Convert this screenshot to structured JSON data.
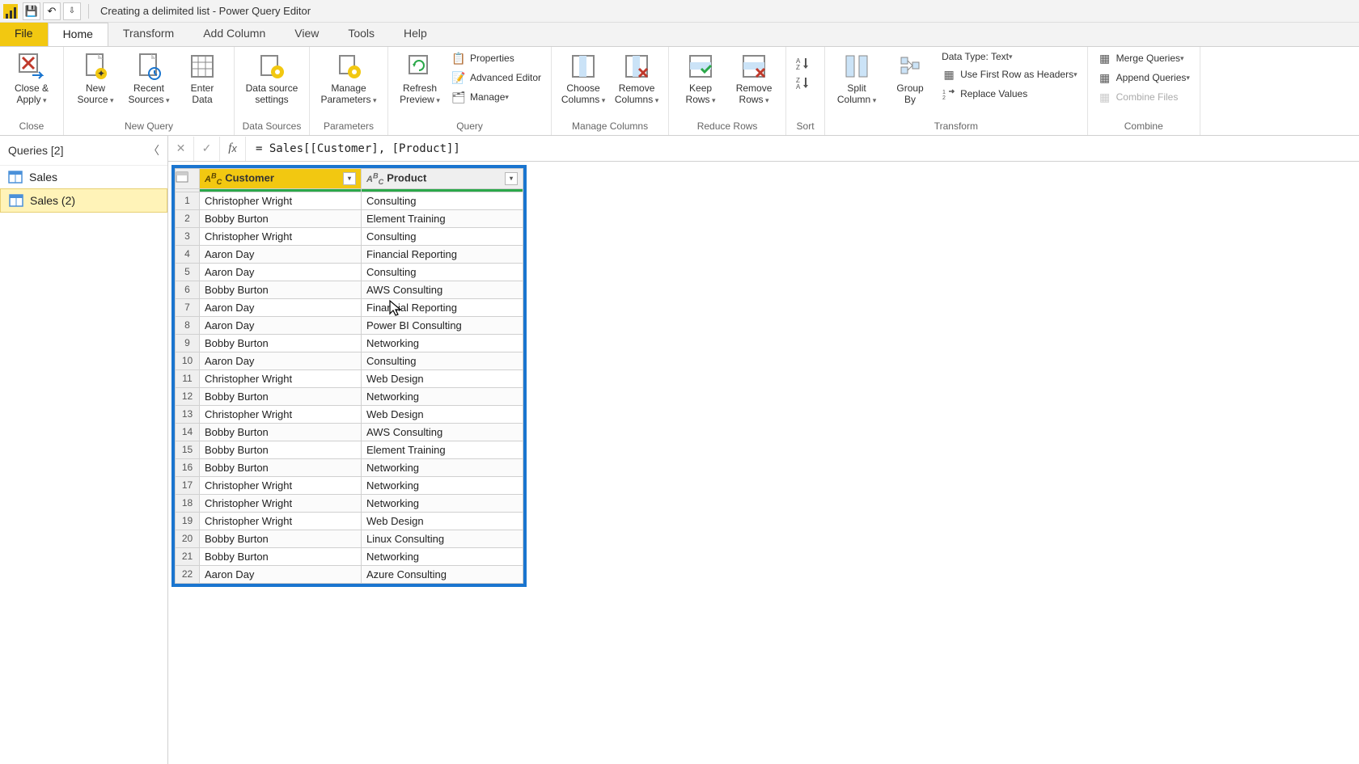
{
  "titlebar": {
    "title": "Creating a delimited list - Power Query Editor"
  },
  "menu": {
    "file": "File",
    "home": "Home",
    "transform": "Transform",
    "addcolumn": "Add Column",
    "view": "View",
    "tools": "Tools",
    "help": "Help"
  },
  "ribbon": {
    "close_apply": "Close &\nApply",
    "close_group": "Close",
    "new_source": "New\nSource",
    "recent_sources": "Recent\nSources",
    "enter_data": "Enter\nData",
    "new_query_group": "New Query",
    "data_source_settings": "Data source\nsettings",
    "data_sources_group": "Data Sources",
    "manage_parameters": "Manage\nParameters",
    "parameters_group": "Parameters",
    "refresh_preview": "Refresh\nPreview",
    "properties": "Properties",
    "advanced_editor": "Advanced Editor",
    "manage": "Manage",
    "query_group": "Query",
    "choose_columns": "Choose\nColumns",
    "remove_columns": "Remove\nColumns",
    "manage_columns_group": "Manage Columns",
    "keep_rows": "Keep\nRows",
    "remove_rows": "Remove\nRows",
    "reduce_rows_group": "Reduce Rows",
    "sort_group": "Sort",
    "split_column": "Split\nColumn",
    "group_by": "Group\nBy",
    "data_type": "Data Type: Text",
    "first_row_headers": "Use First Row as Headers",
    "replace_values": "Replace Values",
    "transform_group": "Transform",
    "merge_queries": "Merge Queries",
    "append_queries": "Append Queries",
    "combine_files": "Combine Files",
    "combine_group": "Combine"
  },
  "queries": {
    "header": "Queries [2]",
    "items": [
      "Sales",
      "Sales (2)"
    ]
  },
  "formula": {
    "value": "= Sales[[Customer], [Product]]"
  },
  "columns": [
    "Customer",
    "Product"
  ],
  "rows": [
    {
      "n": 1,
      "c": "Christopher Wright",
      "p": "Consulting"
    },
    {
      "n": 2,
      "c": "Bobby Burton",
      "p": "Element Training"
    },
    {
      "n": 3,
      "c": "Christopher Wright",
      "p": "Consulting"
    },
    {
      "n": 4,
      "c": "Aaron Day",
      "p": "Financial Reporting"
    },
    {
      "n": 5,
      "c": "Aaron Day",
      "p": "Consulting"
    },
    {
      "n": 6,
      "c": "Bobby Burton",
      "p": "AWS Consulting"
    },
    {
      "n": 7,
      "c": "Aaron Day",
      "p": "Financial Reporting"
    },
    {
      "n": 8,
      "c": "Aaron Day",
      "p": "Power BI Consulting"
    },
    {
      "n": 9,
      "c": "Bobby Burton",
      "p": "Networking"
    },
    {
      "n": 10,
      "c": "Aaron Day",
      "p": "Consulting"
    },
    {
      "n": 11,
      "c": "Christopher Wright",
      "p": "Web Design"
    },
    {
      "n": 12,
      "c": "Bobby Burton",
      "p": "Networking"
    },
    {
      "n": 13,
      "c": "Christopher Wright",
      "p": "Web Design"
    },
    {
      "n": 14,
      "c": "Bobby Burton",
      "p": "AWS Consulting"
    },
    {
      "n": 15,
      "c": "Bobby Burton",
      "p": "Element Training"
    },
    {
      "n": 16,
      "c": "Bobby Burton",
      "p": "Networking"
    },
    {
      "n": 17,
      "c": "Christopher Wright",
      "p": "Networking"
    },
    {
      "n": 18,
      "c": "Christopher Wright",
      "p": "Networking"
    },
    {
      "n": 19,
      "c": "Christopher Wright",
      "p": "Web Design"
    },
    {
      "n": 20,
      "c": "Bobby Burton",
      "p": "Linux Consulting"
    },
    {
      "n": 21,
      "c": "Bobby Burton",
      "p": "Networking"
    },
    {
      "n": 22,
      "c": "Aaron Day",
      "p": "Azure Consulting"
    }
  ]
}
